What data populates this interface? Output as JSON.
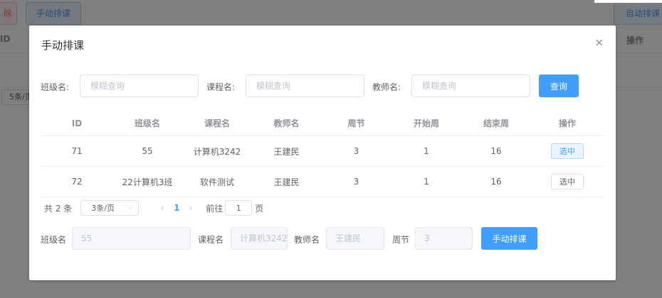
{
  "background": {
    "delete_label": "除",
    "manual_label": "手动排课",
    "auto_label": "自动排课",
    "col_id": "ID",
    "col_op": "操作",
    "page_size": "5条/页"
  },
  "dialog": {
    "title": "手动排课",
    "close_icon": "×"
  },
  "search": {
    "class_label": "班级名:",
    "class_placeholder": "模糊查询",
    "course_label": "课程名:",
    "course_placeholder": "模糊查询",
    "teacher_label": "教师名:",
    "teacher_placeholder": "模糊查询",
    "query_button": "查询"
  },
  "table": {
    "headers": [
      "ID",
      "班级名",
      "课程名",
      "教师名",
      "周节",
      "开始周",
      "结束周",
      "操作"
    ],
    "rows": [
      {
        "id": "71",
        "class_name": "55",
        "course": "计算机3242",
        "teacher": "王建民",
        "section": "3",
        "start_week": "1",
        "end_week": "16",
        "action": "选中",
        "selected": true
      },
      {
        "id": "72",
        "class_name": "22计算机3班",
        "course": "软件测试",
        "teacher": "王建民",
        "section": "3",
        "start_week": "1",
        "end_week": "16",
        "action": "选中",
        "selected": false
      }
    ]
  },
  "pagination": {
    "total": "共 2 条",
    "page_size": "3条/页",
    "prev_icon": "‹",
    "current_page": "1",
    "next_icon": "›",
    "goto_label": "前往",
    "goto_value": "1",
    "page_unit": "页"
  },
  "form": {
    "class_label": "班级名",
    "class_value": "55",
    "course_label": "课程名",
    "course_value": "计算机3242",
    "teacher_label": "教师名",
    "teacher_value": "王建民",
    "section_label": "周节",
    "section_value": "3",
    "submit_button": "手动排课"
  },
  "colors": {
    "primary": "#409eff",
    "danger": "#f56c6c",
    "overlay": "rgba(0,0,0,0.5)"
  }
}
